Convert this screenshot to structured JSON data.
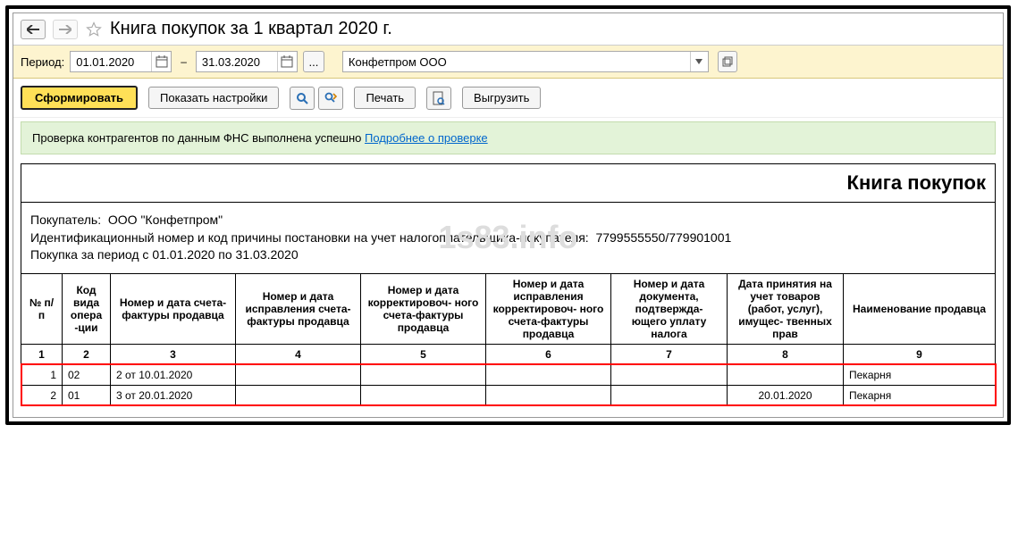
{
  "title": "Книга покупок за 1 квартал 2020 г.",
  "period": {
    "label": "Период:",
    "from": "01.01.2020",
    "to": "31.03.2020",
    "org": "Конфетпром ООО"
  },
  "toolbar": {
    "generate": "Сформировать",
    "show_settings": "Показать настройки",
    "print": "Печать",
    "export": "Выгрузить"
  },
  "status": {
    "text": "Проверка контрагентов по данным ФНС выполнена успешно",
    "link": "Подробнее о проверке"
  },
  "report": {
    "title": "Книга покупок",
    "buyer_label": "Покупатель:",
    "buyer": "ООО \"Конфетпром\"",
    "inn_label": "Идентификационный номер и код причины постановки на учет налогоплательщика-покупателя:",
    "inn": "7799555550/779901001",
    "period_text": "Покупка за период с 01.01.2020 по 31.03.2020",
    "watermark": "1s83.info",
    "headers": {
      "c1": "№ п/п",
      "c2": "Код вида опера -ции",
      "c3": "Номер и дата счета-фактуры продавца",
      "c4": "Номер и дата исправления счета-фактуры продавца",
      "c5": "Номер и дата корректировоч- ного счета-фактуры продавца",
      "c6": "Номер и дата исправления корректировоч- ного счета-фактуры продавца",
      "c7": "Номер и дата документа, подтвержда- ющего уплату налога",
      "c8": "Дата принятия на учет товаров (работ, услуг), имущес- твенных прав",
      "c9": "Наименование продавца"
    },
    "colnums": {
      "c1": "1",
      "c2": "2",
      "c3": "3",
      "c4": "4",
      "c5": "5",
      "c6": "6",
      "c7": "7",
      "c8": "8",
      "c9": "9"
    },
    "rows": [
      {
        "num": "1",
        "opcode": "02",
        "sf": "2 от 10.01.2020",
        "c4": "",
        "c5": "",
        "c6": "",
        "c7": "",
        "c8": "",
        "seller": "Пекарня"
      },
      {
        "num": "2",
        "opcode": "01",
        "sf": "3 от 20.01.2020",
        "c4": "",
        "c5": "",
        "c6": "",
        "c7": "",
        "c8": "20.01.2020",
        "seller": "Пекарня"
      }
    ]
  }
}
